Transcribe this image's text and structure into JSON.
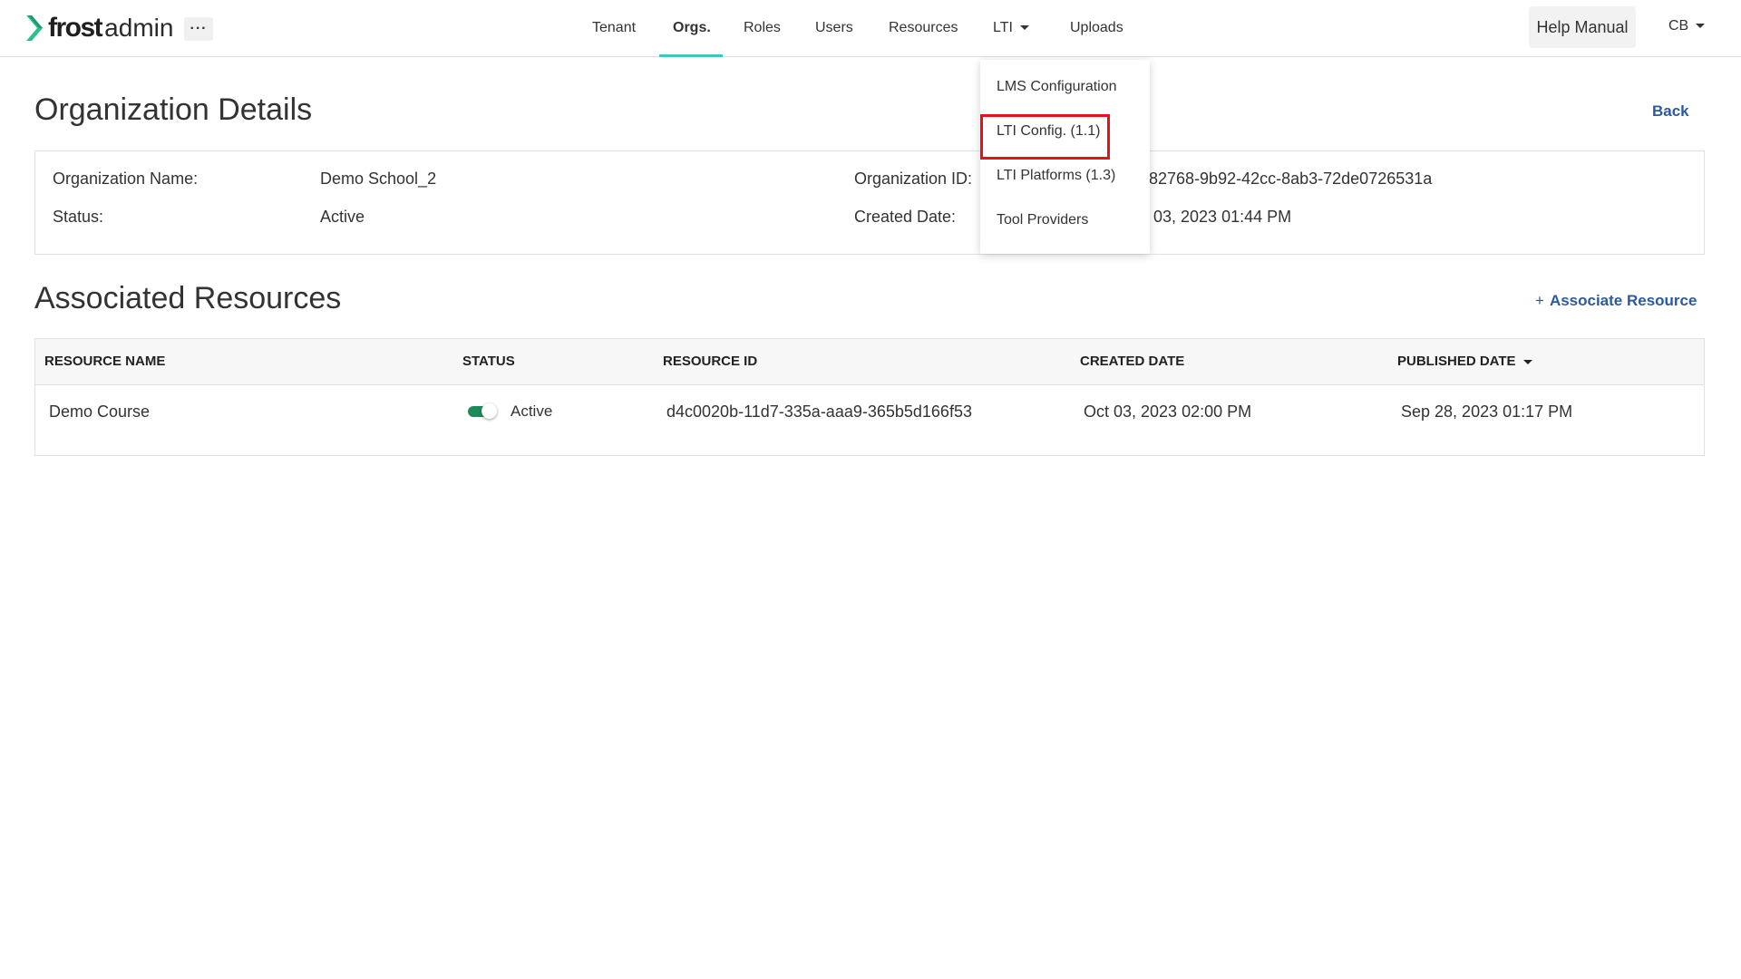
{
  "brand": {
    "name_bold": "frost",
    "name_light": "admin",
    "more_label": "···"
  },
  "nav": {
    "items": [
      {
        "label": "Tenant"
      },
      {
        "label": "Orgs."
      },
      {
        "label": "Roles"
      },
      {
        "label": "Users"
      },
      {
        "label": "Resources"
      },
      {
        "label": "LTI"
      },
      {
        "label": "Uploads"
      }
    ],
    "active": "Orgs.",
    "help_label": "Help Manual",
    "user_initials": "CB"
  },
  "lti_dropdown": {
    "items": [
      {
        "label": "LMS Configuration"
      },
      {
        "label": "LTI Config. (1.1)"
      },
      {
        "label": "LTI Platforms (1.3)"
      },
      {
        "label": "Tool Providers"
      }
    ],
    "highlighted": "LTI Config. (1.1)"
  },
  "details": {
    "title": "Organization Details",
    "back_label": "Back",
    "org_name_label": "Organization Name:",
    "org_name_value": "Demo School_2",
    "status_label": "Status:",
    "status_value": "Active",
    "org_id_label": "Organization ID:",
    "org_id_value_visible": "82768-9b92-42cc-8ab3-72de0726531a",
    "created_label": "Created Date:",
    "created_value_visible": "03, 2023 01:44 PM"
  },
  "resources": {
    "title": "Associated Resources",
    "associate_label": "Associate Resource",
    "columns": [
      "RESOURCE NAME",
      "STATUS",
      "RESOURCE ID",
      "CREATED DATE",
      "PUBLISHED DATE"
    ],
    "rows": [
      {
        "name": "Demo Course",
        "status": "Active",
        "status_on": true,
        "resource_id": "d4c0020b-11d7-335a-aaa9-365b5d166f53",
        "created": "Oct 03, 2023 02:00 PM",
        "published": "Sep 28, 2023 01:17 PM"
      }
    ]
  },
  "colors": {
    "accent_teal": "#3cc7c0",
    "link_blue": "#2c5aa0",
    "toggle_green": "#1e8a5a",
    "highlight_red": "#e8101a",
    "logo_green": "#2fbf8f"
  },
  "icons": [
    "frost-logo-icon",
    "more-horizontal-icon",
    "chevron-down-icon",
    "plus-icon",
    "sort-desc-icon",
    "toggle-switch-icon"
  ]
}
